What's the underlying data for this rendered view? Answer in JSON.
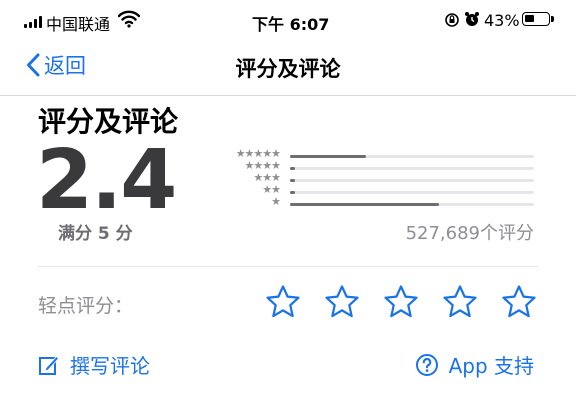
{
  "status_bar": {
    "carrier": "中国联通",
    "time": "下午 6:07",
    "battery_percent": "43%",
    "battery_level": 0.43,
    "icons": [
      "signal-icon",
      "wifi-icon",
      "rotation-lock-icon",
      "alarm-icon",
      "battery-icon"
    ]
  },
  "nav": {
    "back_label": "返回",
    "title": "评分及评论"
  },
  "ratings": {
    "section_title": "评分及评论",
    "average": "2.4",
    "out_of": "满分 5 分",
    "count_text": "527,689个评分",
    "distribution": [
      {
        "stars": "★★★★★",
        "fraction": 0.31
      },
      {
        "stars": "★★★★",
        "fraction": 0.02
      },
      {
        "stars": "★★★",
        "fraction": 0.02
      },
      {
        "stars": "★★",
        "fraction": 0.02
      },
      {
        "stars": "★",
        "fraction": 0.61
      }
    ]
  },
  "tap_to_rate": {
    "label": "轻点评分：",
    "star_count": 5
  },
  "actions": {
    "write_review": "撰写评论",
    "app_support": "App 支持"
  },
  "colors": {
    "accent": "#1a73e8",
    "secondary_text": "#8e8e93",
    "rating_number": "#3a3a3c"
  }
}
